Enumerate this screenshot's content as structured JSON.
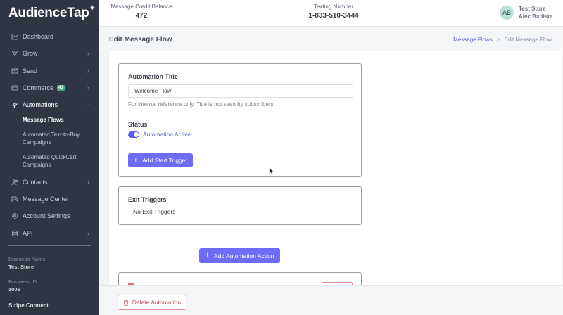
{
  "app": {
    "logo": "AudienceTap"
  },
  "sidebar": {
    "items": [
      {
        "label": "Dashboard",
        "icon": "chart-icon"
      },
      {
        "label": "Grow",
        "icon": "grow-icon"
      },
      {
        "label": "Send",
        "icon": "send-icon"
      },
      {
        "label": "Commerce",
        "icon": "commerce-icon",
        "badge": "43"
      },
      {
        "label": "Automations",
        "icon": "lightning-icon"
      },
      {
        "label": "Contacts",
        "icon": "contacts-icon"
      },
      {
        "label": "Message Center",
        "icon": "chat-icon"
      },
      {
        "label": "Account Settings",
        "icon": "gear-icon"
      },
      {
        "label": "API",
        "icon": "database-icon"
      }
    ],
    "subitems": [
      {
        "label": "Message Flows"
      },
      {
        "label": "Automated Text-to-Buy Campaigns"
      },
      {
        "label": "Automated QuickCart Campaigns"
      }
    ],
    "business_name_label": "Business Name:",
    "business_name": "Test Store",
    "business_id_label": "Business ID:",
    "business_id": "1005",
    "stripe": "Stripe Connect"
  },
  "header": {
    "credit_label": "Message Credit Balance",
    "credit_value": "472",
    "texting_label": "Texting Number",
    "texting_value": "1-833-510-3444",
    "avatar": "AB",
    "store": "Test Store",
    "user": "Alec Battista"
  },
  "page": {
    "title": "Edit Message Flow",
    "breadcrumb_link": "Message Flows",
    "breadcrumb_sep": ">",
    "breadcrumb_current": "Edit Message Flow"
  },
  "form": {
    "automation_title_label": "Automation Title",
    "automation_title_value": "Welcome Flow",
    "help_text": "For internal reference only. Title is not seen by subscribers.",
    "status_label": "Status",
    "status_text": "Automation Active",
    "add_start_trigger": "Add Start Trigger",
    "exit_triggers_label": "Exit Triggers",
    "no_exit_triggers": "No Exit Triggers",
    "add_automation_action": "Add Automation Action"
  },
  "footer": {
    "delete_label": "Delete Automation"
  },
  "colors": {
    "accent": "#6c6cf5",
    "sidebar": "#2f3542",
    "danger": "#d24a5a",
    "badge": "#3fb37f"
  }
}
